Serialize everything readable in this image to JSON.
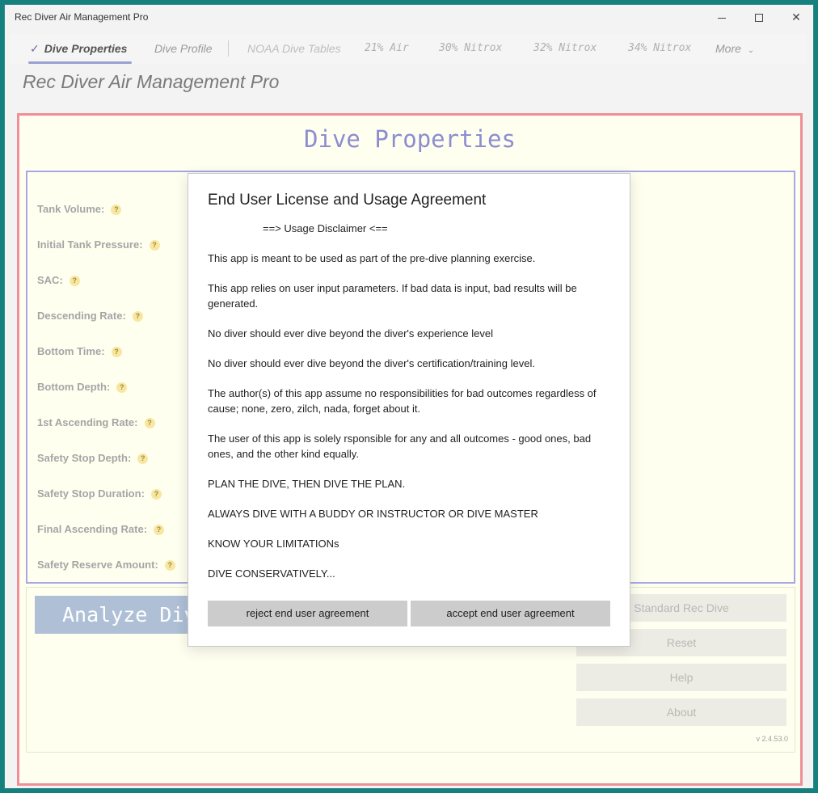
{
  "window": {
    "title": "Rec Diver Air Management Pro"
  },
  "tabs": [
    {
      "label": "Dive Properties"
    },
    {
      "label": "Dive Profile"
    },
    {
      "label": "NOAA Dive Tables"
    },
    {
      "label": "21% Air"
    },
    {
      "label": "30% Nitrox"
    },
    {
      "label": "32% Nitrox"
    },
    {
      "label": "34% Nitrox"
    },
    {
      "label": "More"
    }
  ],
  "app": {
    "title": "Rec Diver Air Management Pro"
  },
  "main": {
    "section_title": "Dive Properties",
    "fields": [
      {
        "label": "Tank Volume:"
      },
      {
        "label": "Initial Tank Pressure:"
      },
      {
        "label": "SAC:"
      },
      {
        "label": "Descending Rate:"
      },
      {
        "label": "Bottom Time:"
      },
      {
        "label": "Bottom Depth:"
      },
      {
        "label": "1st Ascending Rate:"
      },
      {
        "label": "Safety Stop Depth:"
      },
      {
        "label": "Safety Stop Duration:"
      },
      {
        "label": "Final Ascending Rate:"
      },
      {
        "label": "Safety Reserve Amount:"
      }
    ],
    "help_glyph": "?",
    "analyze_label": "Analyze Dive",
    "buttons": {
      "standard": "Standard Rec Dive",
      "reset": "Reset",
      "help": "Help",
      "about": "About"
    },
    "version": "v 2.4.53.0"
  },
  "dialog": {
    "title": "End User License and Usage Agreement",
    "disclaimer": "==> Usage Disclaimer <==",
    "paragraphs": [
      "This app is meant to be used as part of the pre-dive planning exercise.",
      "This app relies on user input parameters. If bad data is input, bad results will be generated.",
      "No diver should ever dive beyond the diver's experience level",
      "No diver should ever dive beyond the diver's certification/training level.",
      "The author(s) of this app assume no responsibilities for bad outcomes regardless of cause; none, zero, zilch, nada, forget about it.",
      "The user of this app is solely rsponsible for any and all outcomes - good ones, bad ones, and the other kind equally.",
      "PLAN THE DIVE, THEN DIVE THE PLAN.",
      "ALWAYS DIVE WITH A BUDDY OR INSTRUCTOR OR DIVE MASTER",
      "KNOW YOUR LIMITATIONs",
      "DIVE CONSERVATIVELY..."
    ],
    "reject_label": "reject end user agreement",
    "accept_label": "accept end user agreement"
  },
  "icons": {
    "check": "check-icon",
    "chevron": "chevron-down-icon"
  },
  "colors": {
    "outer_border": "#f08e95",
    "props_border": "#a7a7e6",
    "section_title": "#8c8cd0",
    "panel_bg": "#fffff0"
  }
}
